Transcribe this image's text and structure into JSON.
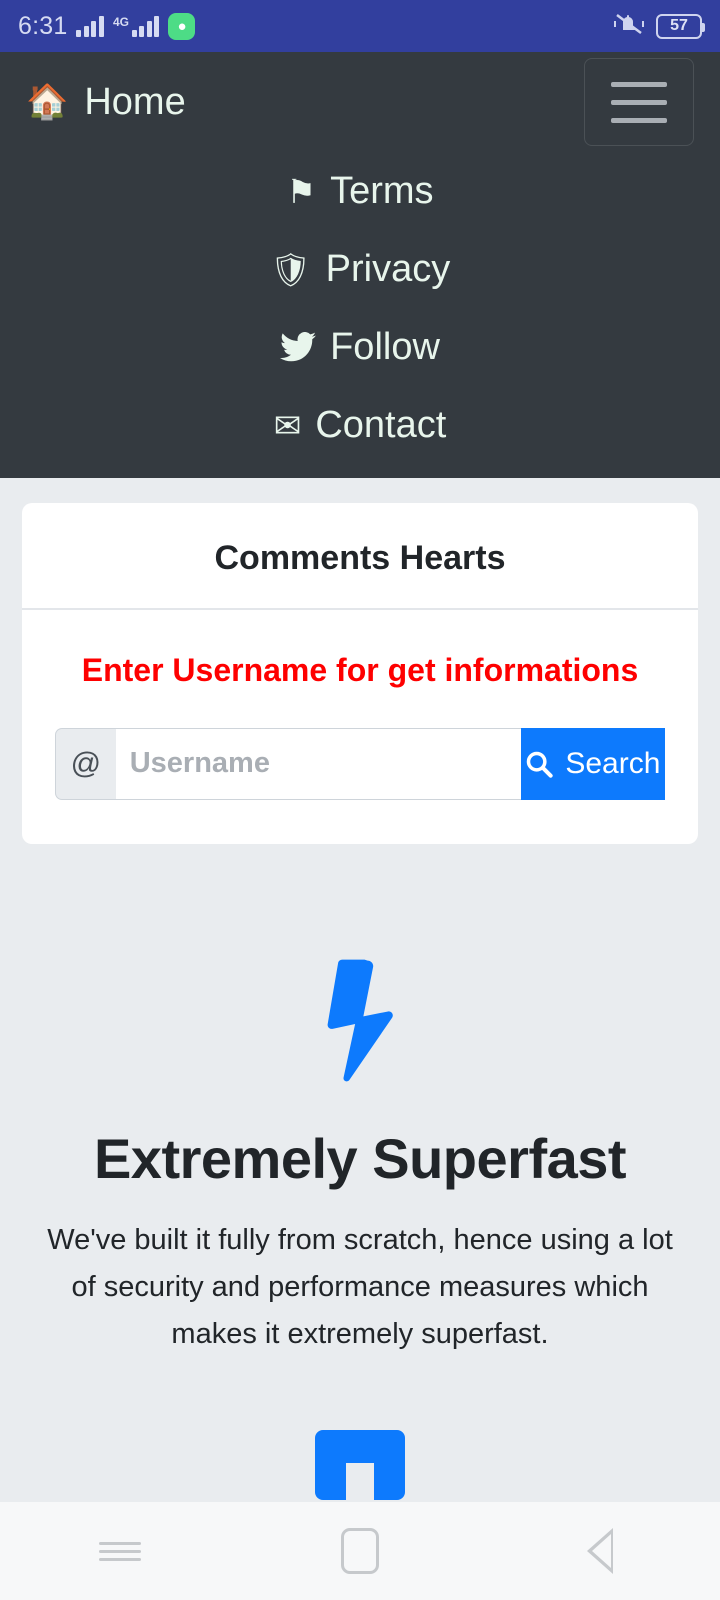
{
  "status_bar": {
    "time": "6:31",
    "network_label": "4G",
    "app_icon": "rocket-app-icon",
    "signal_icon": "signal-bars-icon",
    "silent_icon": "bell-muted-icon",
    "battery_level": "57",
    "background_color": "#323f9e"
  },
  "navbar": {
    "background_color": "#343a40",
    "brand": {
      "label": "Home",
      "icon": "home-icon"
    },
    "toggler": {
      "icon": "hamburger-menu-icon"
    },
    "items": [
      {
        "label": "Terms",
        "icon": "flag-icon"
      },
      {
        "label": "Privacy",
        "icon": "shield-icon"
      },
      {
        "label": "Follow",
        "icon": "twitter-bird-icon"
      },
      {
        "label": "Contact",
        "icon": "envelope-icon"
      }
    ]
  },
  "card": {
    "title": "Comments Hearts",
    "alert": "Enter Username for get informations",
    "alert_color": "#fe0000",
    "search": {
      "prefix": "@",
      "value": "",
      "placeholder": "Username",
      "button_label": "Search",
      "button_icon": "search-icon",
      "button_color": "#0d7afd"
    }
  },
  "feature": {
    "icon": "lightning-bolt-icon",
    "icon_color": "#0d7afd",
    "title": "Extremely Superfast",
    "text": "We've built it fully from scratch, hence using a lot of security and performance measures which makes it extremely superfast.",
    "next_icon": "lock-icon"
  },
  "android_nav": {
    "recents": "recents-icon",
    "home": "home-square-icon",
    "back": "back-triangle-icon"
  }
}
